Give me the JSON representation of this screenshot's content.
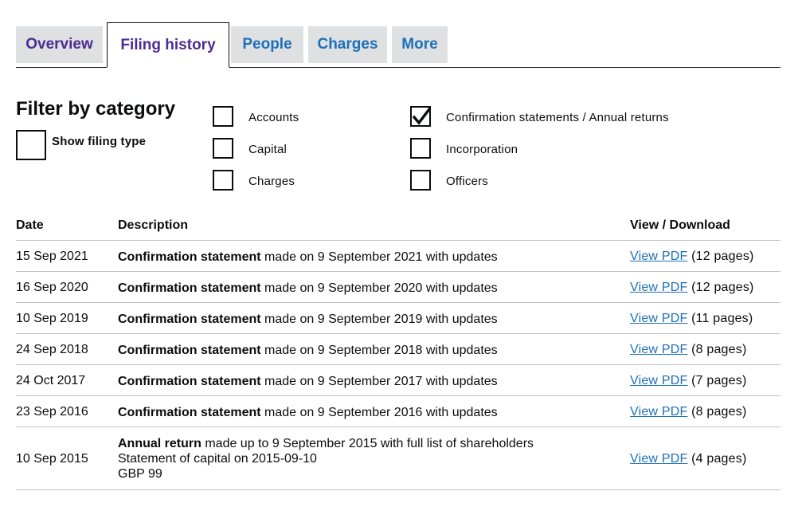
{
  "tabs": [
    {
      "label": "Overview",
      "active": false
    },
    {
      "label": "Filing history",
      "active": true
    },
    {
      "label": "People",
      "active": false
    },
    {
      "label": "Charges",
      "active": false
    },
    {
      "label": "More",
      "active": false
    }
  ],
  "filter": {
    "title": "Filter by category",
    "show_filing_type": {
      "label": "Show filing type",
      "checked": false
    },
    "categories": [
      {
        "label": "Accounts",
        "checked": false
      },
      {
        "label": "Capital",
        "checked": false
      },
      {
        "label": "Charges",
        "checked": false
      },
      {
        "label": "Confirmation statements / Annual returns",
        "checked": true
      },
      {
        "label": "Incorporation",
        "checked": false
      },
      {
        "label": "Officers",
        "checked": false
      }
    ]
  },
  "table": {
    "headers": {
      "date": "Date",
      "description": "Description",
      "view": "View / Download"
    },
    "rows": [
      {
        "date": "15 Sep 2021",
        "type": "Confirmation statement",
        "text": " made on 9 September 2021 with updates",
        "link": "View PDF",
        "pages": "(12 pages)"
      },
      {
        "date": "16 Sep 2020",
        "type": "Confirmation statement",
        "text": " made on 9 September 2020 with updates",
        "link": "View PDF",
        "pages": "(12 pages)"
      },
      {
        "date": "10 Sep 2019",
        "type": "Confirmation statement",
        "text": " made on 9 September 2019 with updates",
        "link": "View PDF",
        "pages": "(11 pages)"
      },
      {
        "date": "24 Sep 2018",
        "type": "Confirmation statement",
        "text": " made on 9 September 2018 with updates",
        "link": "View PDF",
        "pages": "(8 pages)"
      },
      {
        "date": "24 Oct 2017",
        "type": "Confirmation statement",
        "text": " made on 9 September 2017 with updates",
        "link": "View PDF",
        "pages": "(7 pages)"
      },
      {
        "date": "23 Sep 2016",
        "type": "Confirmation statement",
        "text": " made on 9 September 2016 with updates",
        "link": "View PDF",
        "pages": "(8 pages)"
      },
      {
        "date": "10 Sep 2015",
        "type": "Annual return",
        "text": " made up to 9 September 2015 with full list of shareholders",
        "extra1": "Statement of capital on 2015-09-10",
        "extra2": "GBP 99",
        "link": "View PDF",
        "pages": "(4 pages)"
      }
    ]
  }
}
